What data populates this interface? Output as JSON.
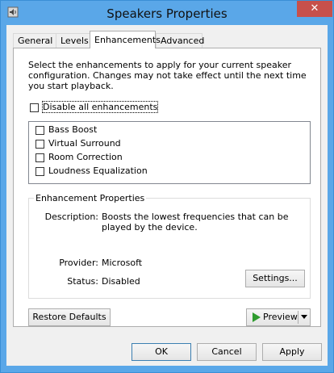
{
  "window": {
    "title": "Speakers Properties",
    "close_glyph": "✕"
  },
  "tabs": [
    {
      "label": "General"
    },
    {
      "label": "Levels"
    },
    {
      "label": "Enhancements",
      "active": true
    },
    {
      "label": "Advanced"
    }
  ],
  "enhancements": {
    "intro": "Select the enhancements to apply for your current speaker configuration. Changes may not take effect until the next time you start playback.",
    "disable_all": {
      "label": "Disable all enhancements",
      "checked": false
    },
    "items": [
      {
        "label": "Bass Boost",
        "checked": false
      },
      {
        "label": "Virtual Surround",
        "checked": false
      },
      {
        "label": "Room Correction",
        "checked": false
      },
      {
        "label": "Loudness Equalization",
        "checked": false
      }
    ]
  },
  "properties": {
    "group_title": "Enhancement Properties",
    "description_key": "Description:",
    "description_value": "Boosts the lowest frequencies that can be played by the device.",
    "provider_key": "Provider:",
    "provider_value": "Microsoft",
    "status_key": "Status:",
    "status_value": "Disabled",
    "settings_label": "Settings..."
  },
  "buttons": {
    "restore_defaults": "Restore Defaults",
    "preview": "Preview",
    "ok": "OK",
    "cancel": "Cancel",
    "apply": "Apply"
  },
  "colors": {
    "titlebar": "#5aa7e8",
    "close": "#c7504b",
    "preview_play": "#2e9b2e"
  },
  "icons": [
    "speaker-icon",
    "close-icon",
    "play-icon",
    "dropdown-arrow-icon"
  ]
}
